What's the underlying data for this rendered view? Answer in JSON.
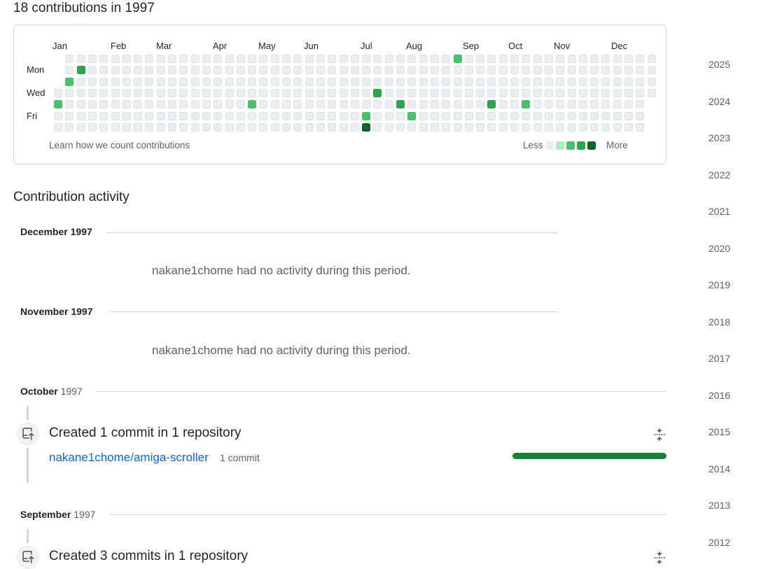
{
  "header": {
    "title": "18 contributions in 1997"
  },
  "graph": {
    "months": [
      "Jan",
      "Feb",
      "Mar",
      "Apr",
      "May",
      "Jun",
      "Jul",
      "Aug",
      "Sep",
      "Oct",
      "Nov",
      "Dec"
    ],
    "day_labels": [
      "Mon",
      "Wed",
      "Fri"
    ],
    "learn_link": "Learn how we count contributions",
    "legend_less": "Less",
    "legend_more": "More",
    "colors": [
      "#ebeef1",
      "#aceebb",
      "#4ac26b",
      "#2da44e",
      "#116329"
    ],
    "weeks": 53,
    "active_cells": [
      {
        "week": 2,
        "day": 1,
        "level": 3
      },
      {
        "week": 1,
        "day": 2,
        "level": 2
      },
      {
        "week": 0,
        "day": 4,
        "level": 2
      },
      {
        "week": 17,
        "day": 4,
        "level": 2
      },
      {
        "week": 27,
        "day": 5,
        "level": 2
      },
      {
        "week": 27,
        "day": 6,
        "level": 4
      },
      {
        "week": 28,
        "day": 3,
        "level": 3
      },
      {
        "week": 30,
        "day": 4,
        "level": 3
      },
      {
        "week": 31,
        "day": 5,
        "level": 2
      },
      {
        "week": 35,
        "day": 0,
        "level": 2
      },
      {
        "week": 38,
        "day": 4,
        "level": 3
      },
      {
        "week": 41,
        "day": 4,
        "level": 2
      }
    ],
    "year_end": {
      "first_week_start_day": 3,
      "last_week_last_day": 3
    }
  },
  "activity": {
    "title": "Contribution activity",
    "months": [
      {
        "month": "December",
        "year": "1997",
        "empty": true,
        "text": "nakane1chome had no activity during this period."
      },
      {
        "month": "November",
        "year": "1997",
        "empty": true,
        "text": "nakane1chome had no activity during this period."
      },
      {
        "month": "October",
        "year": "1997",
        "empty": false,
        "summary": "Created 1 commit in 1 repository",
        "repo": "nakane1chome/amiga-scroller",
        "count": "1 commit"
      },
      {
        "month": "September",
        "year": "1997",
        "empty": false,
        "summary": "Created 3 commits in 1 repository"
      }
    ]
  },
  "years": [
    "2025",
    "2024",
    "2023",
    "2022",
    "2021",
    "2020",
    "2019",
    "2018",
    "2017",
    "2016",
    "2015",
    "2014",
    "2013",
    "2012"
  ],
  "icons": {
    "commit": "repo-push-icon",
    "fold": "fold-icon"
  }
}
